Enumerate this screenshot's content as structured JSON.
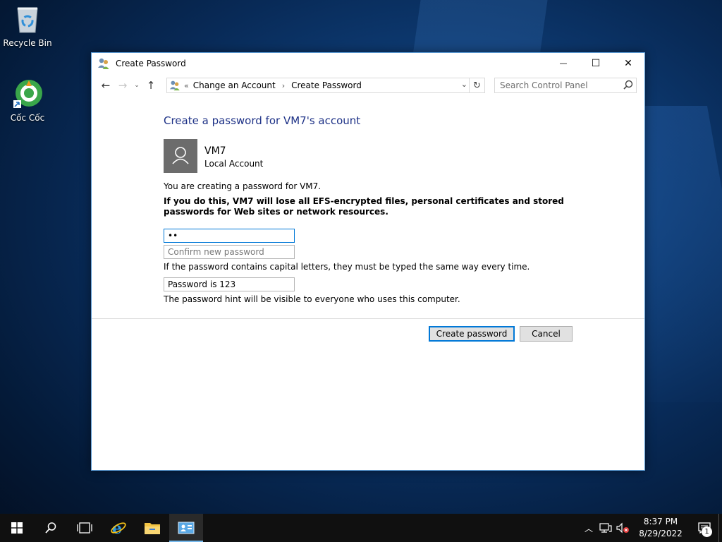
{
  "desktop": {
    "icons": [
      {
        "label": "Recycle Bin",
        "icon": "recycle-bin-icon"
      },
      {
        "label": "Cốc Cốc",
        "icon": "coccoc-browser-icon"
      }
    ]
  },
  "window": {
    "title": "Create Password",
    "controls": {
      "minimize": "—",
      "maximize": "☐",
      "close": "✕"
    },
    "nav": {
      "back": "←",
      "forward": "→",
      "recent": "⌄",
      "up": "↑"
    },
    "address": {
      "overflow": "«",
      "parts": [
        "Change an Account",
        "Create Password"
      ],
      "separator": "›"
    },
    "search": {
      "placeholder": "Search Control Panel"
    }
  },
  "content": {
    "heading": "Create a password for VM7's account",
    "account_name": "VM7",
    "account_type": "Local Account",
    "info": "You are creating a password for VM7.",
    "warning": "If you do this, VM7 will lose all EFS-encrypted files, personal certificates and stored passwords for Web sites or network resources.",
    "new_password_value": "••",
    "confirm_placeholder": "Confirm new password",
    "capital_note": "If the password contains capital letters, they must be typed the same way every time.",
    "hint_value": "Password is 123",
    "hint_note": "The password hint will be visible to everyone who uses this computer.",
    "create_button": "Create password",
    "cancel_button": "Cancel"
  },
  "taskbar": {
    "time": "8:37 PM",
    "date": "8/29/2022",
    "notification_count": "1"
  },
  "colors": {
    "heading": "#1e3287",
    "accent": "#0078d7",
    "taskbar": "#101010"
  }
}
